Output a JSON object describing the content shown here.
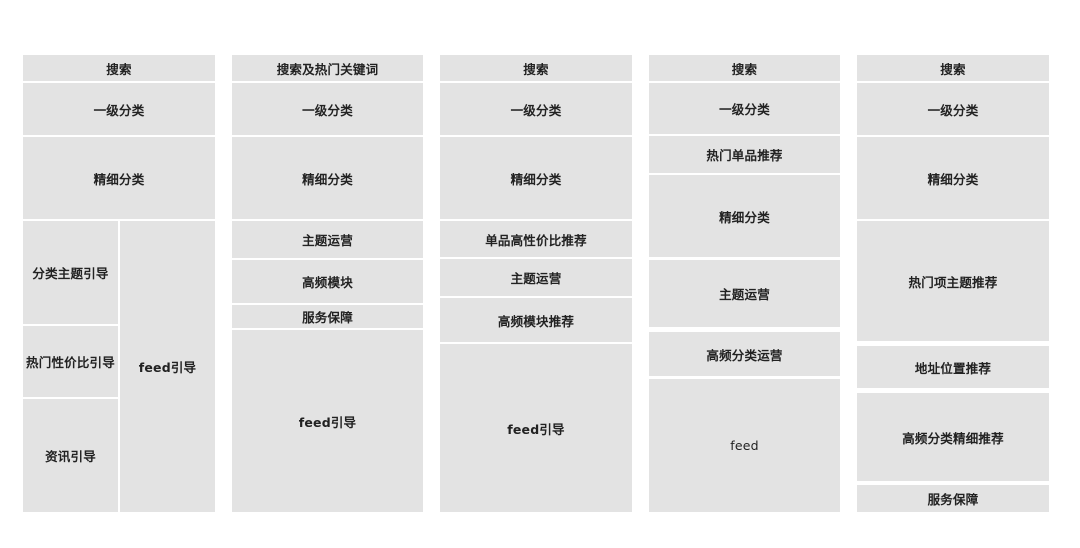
{
  "diagram": {
    "type": "page-layout-wireframes",
    "fill_color": "#e3e3e3",
    "text_color": "#222222",
    "columns": [
      {
        "name": "layout-1",
        "blocks": [
          {
            "label": "搜索"
          },
          {
            "label": "一级分类"
          },
          {
            "label": "精细分类"
          },
          {
            "label": "分类主题引导"
          },
          {
            "label": "热门性价比引导"
          },
          {
            "label": "资讯引导"
          },
          {
            "label": "feed引导"
          }
        ]
      },
      {
        "name": "layout-2",
        "blocks": [
          {
            "label": "搜索及热门关键词"
          },
          {
            "label": "一级分类"
          },
          {
            "label": "精细分类"
          },
          {
            "label": "主题运营"
          },
          {
            "label": "高频模块"
          },
          {
            "label": "服务保障"
          },
          {
            "label": "feed引导"
          }
        ]
      },
      {
        "name": "layout-3",
        "blocks": [
          {
            "label": "搜索"
          },
          {
            "label": "一级分类"
          },
          {
            "label": "精细分类"
          },
          {
            "label": "单品高性价比推荐"
          },
          {
            "label": "主题运营"
          },
          {
            "label": "高频模块推荐"
          },
          {
            "label": "feed引导"
          }
        ]
      },
      {
        "name": "layout-4",
        "blocks": [
          {
            "label": "搜索"
          },
          {
            "label": "一级分类"
          },
          {
            "label": "热门单品推荐"
          },
          {
            "label": "精细分类"
          },
          {
            "label": "主题运营"
          },
          {
            "label": "高频分类运营"
          },
          {
            "label": "feed"
          }
        ]
      },
      {
        "name": "layout-5",
        "blocks": [
          {
            "label": "搜索"
          },
          {
            "label": "一级分类"
          },
          {
            "label": "精细分类"
          },
          {
            "label": "热门项主题推荐"
          },
          {
            "label": "地址位置推荐"
          },
          {
            "label": "高频分类精细推荐"
          },
          {
            "label": "服务保障"
          }
        ]
      }
    ]
  }
}
